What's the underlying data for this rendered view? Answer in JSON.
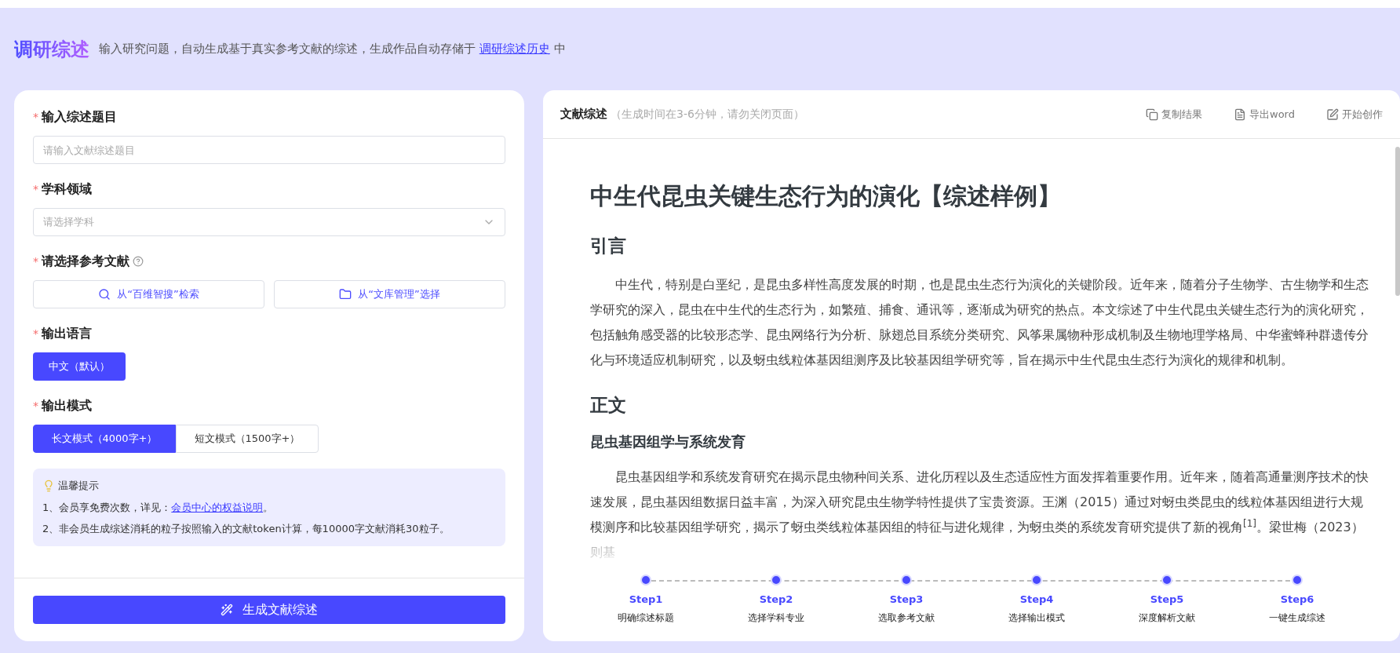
{
  "header": {
    "title": "调研综述",
    "description": "输入研究问题，自动生成基于真实参考文献的综述，生成作品自动存储于",
    "link": "调研综述历史",
    "suffix": "中"
  },
  "form": {
    "topic": {
      "required": "*",
      "label": "输入综述题目",
      "placeholder": "请输入文献综述题目"
    },
    "subject": {
      "required": "*",
      "label": "学科领域",
      "placeholder": "请选择学科"
    },
    "references": {
      "required": "*",
      "label": "请选择参考文献",
      "buttons": [
        {
          "kind": "search",
          "label": "从“百维智搜”检索"
        },
        {
          "kind": "folder",
          "label": "从“文库管理”选择"
        }
      ]
    },
    "language": {
      "required": "*",
      "label": "输出语言",
      "options": [
        {
          "label": "中文（默认）",
          "selected": true
        }
      ]
    },
    "mode": {
      "required": "*",
      "label": "输出模式",
      "options": [
        {
          "label": "长文模式（4000字+）",
          "selected": true
        },
        {
          "label": "短文模式（1500字+）",
          "selected": false
        }
      ]
    },
    "tips": {
      "title": "温馨提示",
      "items": [
        {
          "text": "1、会员享免费次数，详见：",
          "link": "会员中心的权益说明",
          "suffix": "。"
        },
        {
          "text": "2、非会员生成综述消耗的粒子按照输入的文献token计算，每10000字文献消耗30粒子。"
        }
      ]
    },
    "submit": "生成文献综述"
  },
  "result": {
    "title": "文献综述",
    "hint": "（生成时间在3-6分钟，请勿关闭页面）",
    "actions": [
      {
        "kind": "copy",
        "label": "复制结果"
      },
      {
        "kind": "word",
        "label": "导出word"
      },
      {
        "kind": "edit",
        "label": "开始创作"
      }
    ],
    "document": {
      "title": "中生代昆虫关键生态行为的演化【综述样例】",
      "blocks": [
        {
          "kind": "h2",
          "text": "引言"
        },
        {
          "kind": "p",
          "text": "中生代，特别是白垩纪，是昆虫多样性高度发展的时期，也是昆虫生态行为演化的关键阶段。近年来，随着分子生物学、古生物学和生态学研究的深入，昆虫在中生代的生态行为，如繁殖、捕食、通讯等，逐渐成为研究的热点。本文综述了中生代昆虫关键生态行为的演化研究，包括触角感受器的比较形态学、昆虫网络行为分析、脉翅总目系统分类研究、风筝果属物种形成机制及生物地理学格局、中华蜜蜂种群遗传分化与环境适应机制研究，以及蚜虫线粒体基因组测序及比较基因组学研究等，旨在揭示中生代昆虫生态行为演化的规律和机制。"
        },
        {
          "kind": "h2",
          "text": "正文"
        },
        {
          "kind": "h3",
          "text": "昆虫基因组学与系统发育"
        },
        {
          "kind": "p",
          "text": "昆虫基因组学和系统发育研究在揭示昆虫物种间关系、进化历程以及生态适应性方面发挥着重要作用。近年来，随着高通量测序技术的快速发展，昆虫基因组数据日益丰富，为深入研究昆虫生物学特性提供了宝贵资源。王渊（2015）通过对蚜虫类昆虫的线粒体基因组进行大规模测序和比较基因组学研究，揭示了蚜虫类线粒体基因组的特征与进化规律，为蚜虫类的系统发育研究提供了新的视角$^{[1]}$。梁世梅（2023）则基"
        }
      ]
    },
    "steps": [
      {
        "step": "Step1",
        "label": "明确综述标题"
      },
      {
        "step": "Step2",
        "label": "选择学科专业"
      },
      {
        "step": "Step3",
        "label": "选取参考文献"
      },
      {
        "step": "Step4",
        "label": "选择输出模式"
      },
      {
        "step": "Step5",
        "label": "深度解析文献"
      },
      {
        "step": "Step6",
        "label": "一键生成综述"
      }
    ]
  }
}
